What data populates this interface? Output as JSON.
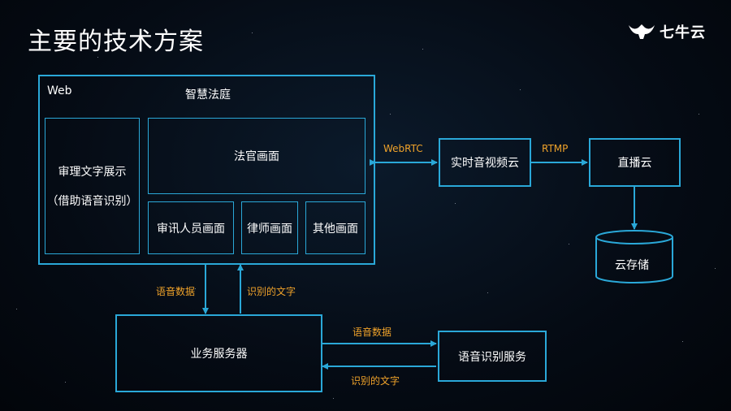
{
  "title": "主要的技术方案",
  "logo": {
    "text": "七牛云",
    "icon": "qiniu-logo-icon"
  },
  "colors": {
    "line": "#2aa8d8",
    "edge_label": "#f0a32a",
    "text": "#ffffff"
  },
  "web": {
    "label": "Web",
    "app_name": "智慧法庭",
    "text_display": "审理文字展示",
    "text_display_note": "（借助语音识别）",
    "judge_view": "法官画面",
    "trial_staff_view": "审讯人员画面",
    "lawyer_view": "律师画面",
    "other_view": "其他画面"
  },
  "rtc": "实时音视频云",
  "live": "直播云",
  "storage": "云存储",
  "biz_server": "业务服务器",
  "asr": "语音识别服务",
  "edges": {
    "webrtc": "WebRTC",
    "rtmp": "RTMP",
    "voice_down": "语音数据",
    "text_up": "识别的文字",
    "voice_right": "语音数据",
    "text_left": "识别的文字"
  }
}
